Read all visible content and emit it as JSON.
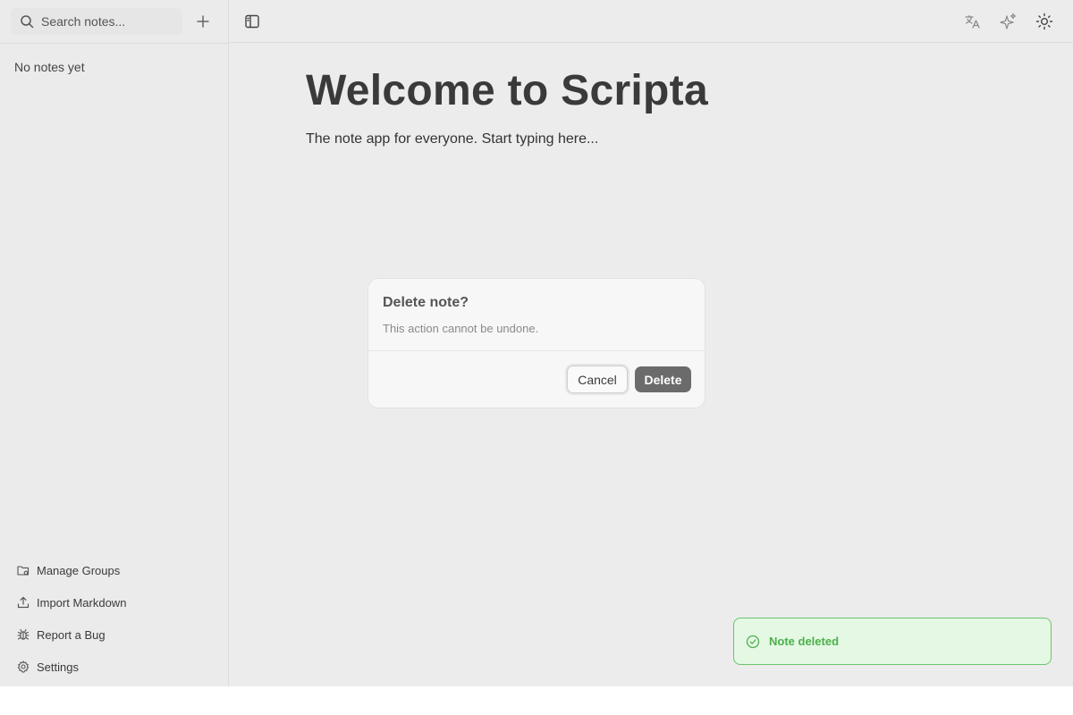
{
  "sidebar": {
    "search": {
      "placeholder": "Search notes..."
    },
    "empty_text": "No notes yet",
    "footer": [
      {
        "label": "Manage Groups",
        "icon": "folder-settings-icon"
      },
      {
        "label": "Import Markdown",
        "icon": "upload-icon"
      },
      {
        "label": "Report a Bug",
        "icon": "bug-icon"
      },
      {
        "label": "Settings",
        "icon": "gear-icon"
      }
    ]
  },
  "topbar": {
    "icons": [
      "sidebar-toggle-icon",
      "translate-icon",
      "sparkles-icon",
      "sun-icon"
    ]
  },
  "editor": {
    "title": "Welcome to Scripta",
    "body": "The note app for everyone. Start typing here..."
  },
  "dialog": {
    "title": "Delete note?",
    "description": "This action cannot be undone.",
    "cancel_label": "Cancel",
    "delete_label": "Delete"
  },
  "toast": {
    "message": "Note deleted",
    "color": "#4cb04c"
  },
  "colors": {
    "background": "#ececec",
    "danger_button": "#6b6b6b",
    "toast_bg": "#e4f8e4",
    "toast_border": "#6cc46c"
  }
}
